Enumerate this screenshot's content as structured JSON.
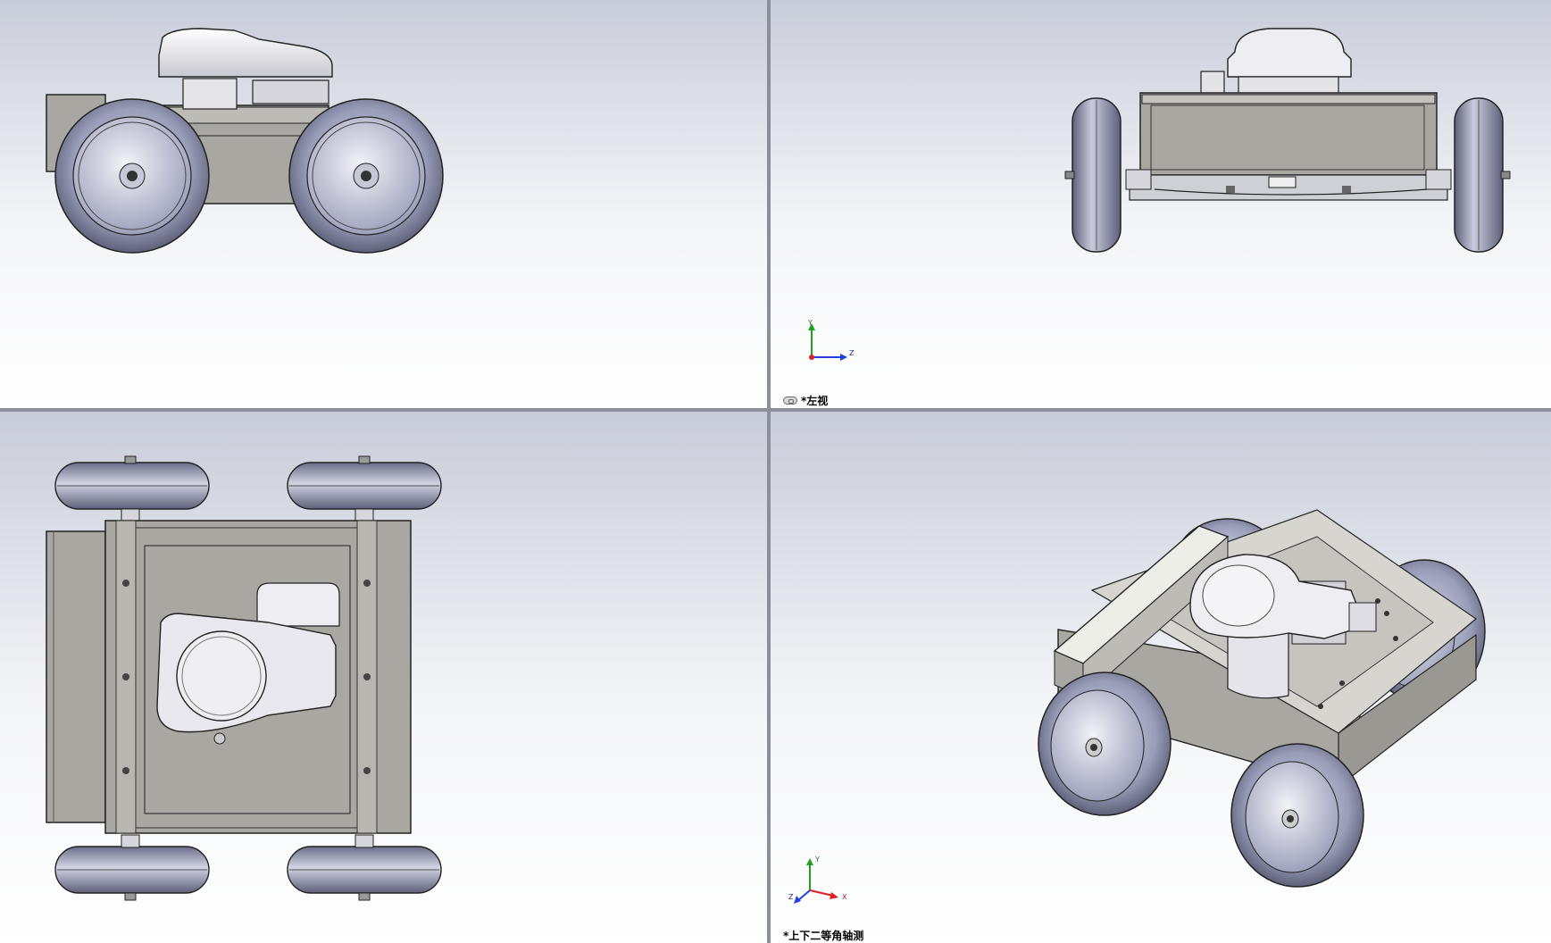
{
  "viewports": {
    "top_left": {
      "name": "front-view"
    },
    "top_right": {
      "name": "left-view",
      "label": "*左视",
      "triad": {
        "y_label": "Y",
        "z_label": "Z"
      }
    },
    "bottom_left": {
      "name": "top-view"
    },
    "bottom_right": {
      "name": "dimetric-view",
      "label": "*上下二等角轴测",
      "triad": {
        "y_label": "Y",
        "x_label": "X",
        "z_label": "Z"
      }
    }
  },
  "colors": {
    "tire": "#8c8fa8",
    "tire_dark": "#4b4e66",
    "rim": "#a9acc2",
    "body": "#a9a7a2",
    "body_dark": "#6f6d69",
    "cover": "#e6e6ea",
    "axis_x": "#e02020",
    "axis_y": "#20a020",
    "axis_z": "#2040e0"
  }
}
